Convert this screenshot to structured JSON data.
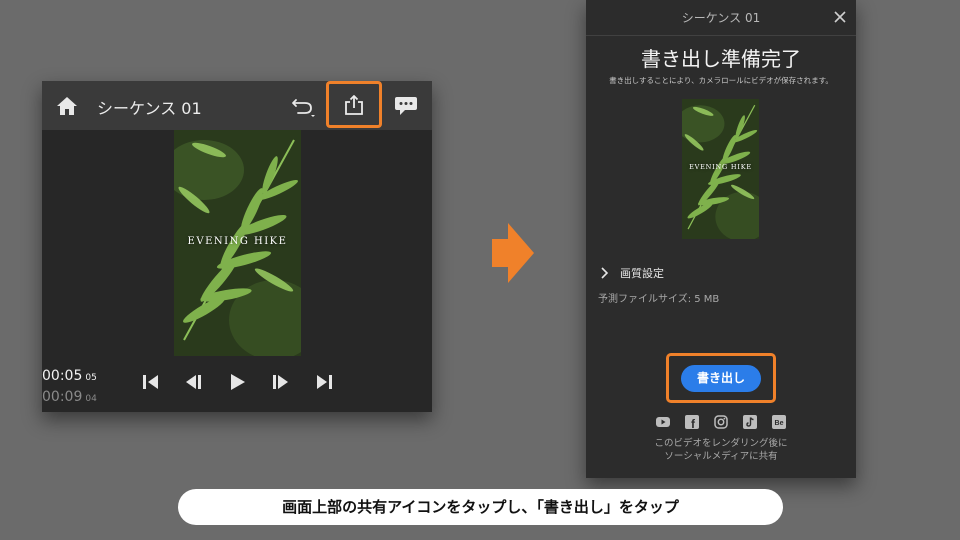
{
  "colors": {
    "background": "#6b6b6b",
    "highlight_outline": "#f0812a",
    "export_button": "#2b7de9",
    "panel": "#272727",
    "dialog": "#2c2c2c"
  },
  "editor": {
    "title": "シーケンス 01",
    "icons": [
      "home-icon",
      "undo-icon",
      "share-icon",
      "comment-icon"
    ],
    "video_overlay_text": "EVENING HIKE",
    "timecode": {
      "current": "00:05",
      "current_frames": "05",
      "total": "00:09",
      "total_frames": "04"
    },
    "transport_icons": [
      "skip-to-start-icon",
      "step-back-icon",
      "play-icon",
      "step-forward-icon",
      "skip-to-end-icon"
    ]
  },
  "export_dialog": {
    "header_title": "シーケンス 01",
    "heading": "書き出し準備完了",
    "subtitle": "書き出しすることにより、カメラロールにビデオが保存されます。",
    "video_overlay_text": "EVENING HIKE",
    "quality_label": "画質設定",
    "file_size": "予測ファイルサイズ: 5 MB",
    "export_button": "書き出し",
    "social_icons": [
      "youtube-icon",
      "facebook-icon",
      "instagram-icon",
      "tiktok-icon",
      "behance-icon"
    ],
    "social_glyphs": {
      "facebook": "f",
      "behance": "Be"
    },
    "note_line1": "このビデオをレンダリング後に",
    "note_line2": "ソーシャルメディアに共有"
  },
  "caption": "画面上部の共有アイコンをタップし、「書き出し」をタップ"
}
